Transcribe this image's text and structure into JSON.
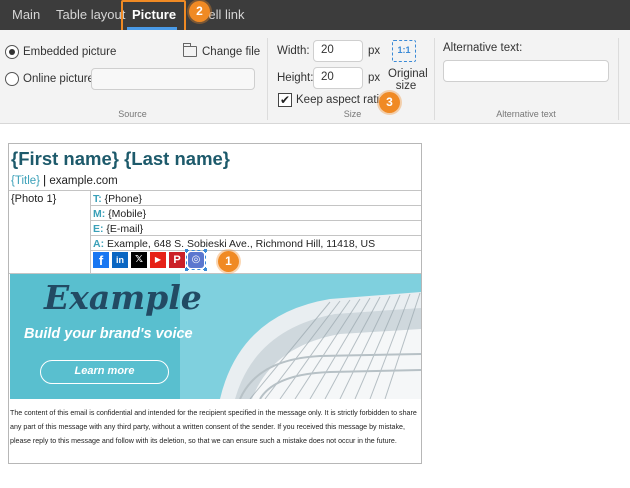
{
  "tabs": [
    {
      "label": "Main"
    },
    {
      "label": "Table layout"
    },
    {
      "label": "Picture",
      "active": true
    },
    {
      "label": "Cell link"
    }
  ],
  "callouts": [
    "1",
    "2",
    "3"
  ],
  "source_group": {
    "embedded_label": "Embedded picture",
    "online_label": "Online picture:",
    "online_value": "",
    "change_file_label": "Change file",
    "change_file_icon": "folder-icon",
    "group_label": "Source",
    "selected": "embedded"
  },
  "size_group": {
    "width_label": "Width:",
    "width_value": "20",
    "height_label": "Height:",
    "height_value": "20",
    "unit": "px",
    "original_size_label_1": "Original",
    "original_size_label_2": "size",
    "original_icon_text": "1:1",
    "keep_aspect_label": "Keep aspect ratio",
    "keep_aspect_checked": true,
    "checkmark": "✔",
    "group_label": "Size"
  },
  "alt_group": {
    "label": "Alternative text:",
    "value": "",
    "group_label": "Alternative text"
  },
  "signature": {
    "name": "{First name} {Last name}",
    "title": "{Title}",
    "separator": " | ",
    "domain": "example.com",
    "photo": "{Photo 1}",
    "rows": [
      {
        "key": "T:",
        "value": " {Phone}"
      },
      {
        "key": "M:",
        "value": " {Mobile}"
      },
      {
        "key": "E:",
        "value": " {E-mail}"
      },
      {
        "key": "A:",
        "value": " Example, 648 S. Sobieski Ave., Richmond Hill, 11418, US"
      }
    ],
    "social_icons": [
      {
        "name": "facebook-icon",
        "glyph": "f"
      },
      {
        "name": "linkedin-icon",
        "glyph": "in"
      },
      {
        "name": "x-icon",
        "glyph": "𝕏"
      },
      {
        "name": "youtube-icon",
        "glyph": "▶"
      },
      {
        "name": "pinterest-icon",
        "glyph": "P"
      },
      {
        "name": "instagram-icon",
        "glyph": "◎"
      }
    ],
    "banner": {
      "title": "Example",
      "subtitle": "Build your brand's voice",
      "button": "Learn more",
      "bg_color": "#59bfcf"
    },
    "disclaimer": "The content of this email is confidential and intended for the recipient specified in the message only. It is strictly forbidden to share any part of this message with any third party, without a written consent of the sender. If you received this message by mistake, please reply to this message and follow with its deletion, so that we can ensure such a mistake does not occur in the future."
  },
  "colors": {
    "tabbar": "#3c3c3c",
    "accent": "#f08a24",
    "link_blue": "#3aa0b8",
    "name_color": "#1d5a6b"
  }
}
